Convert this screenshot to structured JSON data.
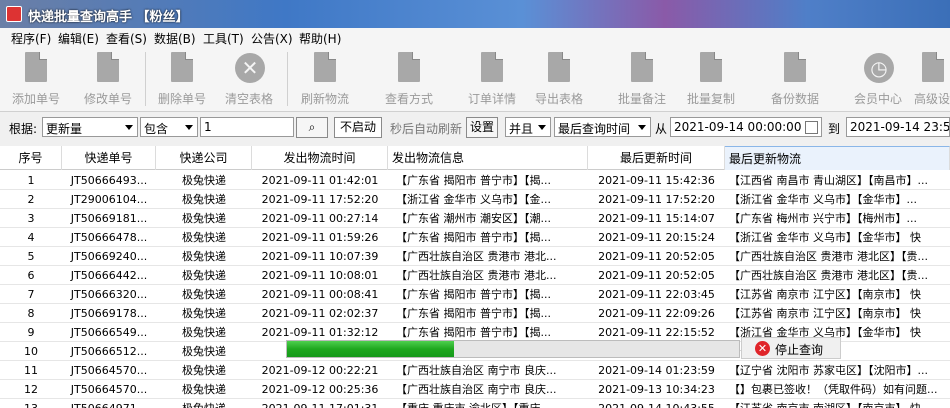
{
  "window": {
    "title": "快递批量查询高手 【粉丝】"
  },
  "menu": [
    "程序(F)",
    "编辑(E)",
    "查看(S)",
    "数据(B)",
    "工具(T)",
    "公告(X)",
    "帮助(H)"
  ],
  "toolbar": [
    {
      "label": "添加单号",
      "icon": "add-doc-icon"
    },
    {
      "label": "修改单号",
      "icon": "edit-doc-icon"
    },
    {
      "label": "删除单号",
      "icon": "delete-doc-icon"
    },
    {
      "label": "清空表格",
      "icon": "clear-table-icon"
    },
    {
      "label": "刷新物流",
      "icon": "refresh-icon"
    },
    {
      "label": "查看方式",
      "icon": "view-mode-icon"
    },
    {
      "label": "订单详情",
      "icon": "order-detail-icon"
    },
    {
      "label": "导出表格",
      "icon": "export-icon"
    },
    {
      "label": "批量备注",
      "icon": "batch-note-icon"
    },
    {
      "label": "批量复制",
      "icon": "batch-copy-icon"
    },
    {
      "label": "备份数据",
      "icon": "backup-icon"
    },
    {
      "label": "会员中心",
      "icon": "member-center-icon"
    },
    {
      "label": "高级设",
      "icon": "advanced-settings-icon"
    }
  ],
  "filter": {
    "label": "根据:",
    "field": "更新量",
    "op": "包含",
    "value": "1",
    "not_start": "不启动",
    "auto_refresh": "秒后自动刷新",
    "settings": "设置",
    "logic": "并且",
    "time_field": "最后查询时间",
    "from_label": "从",
    "from_value": "2021-09-14 00:00:00",
    "to_label": "到",
    "to_value": "2021-09-14 23:59:"
  },
  "columns": [
    "序号",
    "快递单号",
    "快递公司",
    "发出物流时间",
    "发出物流信息",
    "最后更新时间",
    "最后更新物流"
  ],
  "rows": [
    {
      "no": "1",
      "tracking": "JT50666493...",
      "company": "极兔快递",
      "send_time": "2021-09-11 01:42:01",
      "send_info": "【广东省 揭阳市 普宁市】【揭...",
      "last_time": "2021-09-11 15:42:36",
      "last_info": "【江西省 南昌市 青山湖区】【南昌市】..."
    },
    {
      "no": "2",
      "tracking": "JT29006104...",
      "company": "极兔快递",
      "send_time": "2021-09-11 17:52:20",
      "send_info": "【浙江省 金华市 义乌市】【金...",
      "last_time": "2021-09-11 17:52:20",
      "last_info": "【浙江省 金华市 义乌市】【金华市】..."
    },
    {
      "no": "3",
      "tracking": "JT50669181...",
      "company": "极兔快递",
      "send_time": "2021-09-11 00:27:14",
      "send_info": "【广东省 潮州市 潮安区】【潮...",
      "last_time": "2021-09-11 15:14:07",
      "last_info": "【广东省 梅州市 兴宁市】【梅州市】..."
    },
    {
      "no": "4",
      "tracking": "JT50666478...",
      "company": "极兔快递",
      "send_time": "2021-09-11 01:59:26",
      "send_info": "【广东省 揭阳市 普宁市】【揭...",
      "last_time": "2021-09-11 20:15:24",
      "last_info": "【浙江省 金华市 义乌市】【金华市】 快"
    },
    {
      "no": "5",
      "tracking": "JT50669240...",
      "company": "极兔快递",
      "send_time": "2021-09-11 10:07:39",
      "send_info": "【广西壮族自治区 贵港市 港北...",
      "last_time": "2021-09-11 20:52:05",
      "last_info": "【广西壮族自治区 贵港市 港北区】【贵..."
    },
    {
      "no": "6",
      "tracking": "JT50666442...",
      "company": "极兔快递",
      "send_time": "2021-09-11 10:08:01",
      "send_info": "【广西壮族自治区 贵港市 港北...",
      "last_time": "2021-09-11 20:52:05",
      "last_info": "【广西壮族自治区 贵港市 港北区】【贵..."
    },
    {
      "no": "7",
      "tracking": "JT50666320...",
      "company": "极兔快递",
      "send_time": "2021-09-11 00:08:41",
      "send_info": "【广东省 揭阳市 普宁市】【揭...",
      "last_time": "2021-09-11 22:03:45",
      "last_info": "【江苏省 南京市 江宁区】【南京市】 快"
    },
    {
      "no": "8",
      "tracking": "JT50669178...",
      "company": "极兔快递",
      "send_time": "2021-09-11 02:02:37",
      "send_info": "【广东省 揭阳市 普宁市】【揭...",
      "last_time": "2021-09-11 22:09:26",
      "last_info": "【江苏省 南京市 江宁区】【南京市】 快"
    },
    {
      "no": "9",
      "tracking": "JT50666549...",
      "company": "极兔快递",
      "send_time": "2021-09-11 01:32:12",
      "send_info": "【广东省 揭阳市 普宁市】【揭...",
      "last_time": "2021-09-11 22:15:52",
      "last_info": "【浙江省 金华市 义乌市】【金华市】 快"
    },
    {
      "no": "10",
      "tracking": "JT50666512...",
      "company": "极兔快递",
      "send_time": "2021",
      "send_info": "",
      "last_time": "",
      "last_info": "江宁区】【南京市】 快"
    },
    {
      "no": "11",
      "tracking": "JT50664570...",
      "company": "极兔快递",
      "send_time": "2021-09-12 00:22:21",
      "send_info": "【广西壮族自治区 南宁市 良庆...",
      "last_time": "2021-09-14 01:23:59",
      "last_info": "【辽宁省 沈阳市 苏家屯区】【沈阳市】..."
    },
    {
      "no": "12",
      "tracking": "JT50664570...",
      "company": "极兔快递",
      "send_time": "2021-09-12 00:25:36",
      "send_info": "【广西壮族自治区 南宁市 良庆...",
      "last_time": "2021-09-13 10:34:23",
      "last_info": "【】包裹已签收！（凭取件码）如有问题..."
    },
    {
      "no": "13",
      "tracking": "JT50664971...",
      "company": "极兔快递",
      "send_time": "2021-09-11 17:01:31",
      "send_info": "【重庆 重庆市 渝北区】【重庆...",
      "last_time": "2021-09-14 10:43:55",
      "last_info": "【江苏省 南京市 南湖区】【南京市】 快"
    }
  ],
  "progress": {
    "value": 0.37,
    "stop_label": "停止查询"
  },
  "colors": {
    "progress": "#22aa22",
    "stop": "#e0252a",
    "active_header": "#eaf2fc"
  }
}
